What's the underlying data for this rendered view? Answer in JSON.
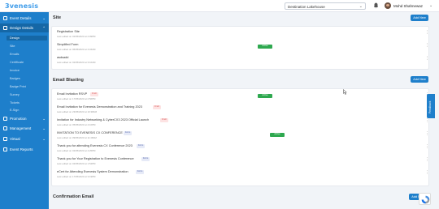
{
  "app": {
    "logo": "3venesis"
  },
  "header": {
    "event_select": "Destination Lakehouse",
    "user_name": "Mohd Shahnewaz"
  },
  "sidebar": {
    "items": [
      {
        "label": "Event Details",
        "chevron": "⌄"
      },
      {
        "label": "Design Details",
        "chevron": "⌃",
        "active": true
      },
      {
        "label": "Promotion",
        "chevron": "⌄"
      },
      {
        "label": "Management",
        "chevron": "⌄"
      },
      {
        "label": "Virtual",
        "chevron": "⌄"
      },
      {
        "label": "Event Reports",
        "chevron": ""
      }
    ],
    "sub_items": [
      "Design",
      "Site",
      "Emails",
      "Certificate",
      "Invoice",
      "Badges",
      "Badge Print",
      "Survey",
      "Tickets",
      "E-Sign"
    ]
  },
  "sections": {
    "site": {
      "title": "Site",
      "add_label": "Add New",
      "rows": [
        {
          "name": "Registration Site",
          "date": "Last edited on 02/05/2023 at 2:09PM",
          "tag": "",
          "badge": ""
        },
        {
          "name": "Simplified Form",
          "date": "Last edited on 06/05/2023 at 4:34AM",
          "tag": "",
          "badge": "Active"
        },
        {
          "name": "asdsadd",
          "date": "Last edited on 02/05/2023 at 3:10AM",
          "tag": "",
          "badge": ""
        }
      ]
    },
    "email": {
      "title": "Email Blasting",
      "add_label": "Add New",
      "rows": [
        {
          "name": "Email Invitation RSVP",
          "date": "Last edited on 17/05/2023 at 2:56PM",
          "tag": "Draft",
          "tag_type": "draft",
          "badge": "Active"
        },
        {
          "name": "Email Invitation for Evenesis Demonstration and Training 2023",
          "date": "Last edited on 23/05/2023 at 10:38AM",
          "tag": "Draft",
          "tag_type": "draft",
          "badge": ""
        },
        {
          "name": "Invitation for Industry Networking & CyberCX3 2023 Official Launch",
          "date": "Last edited on 05/05/2023 at 4:10PM",
          "tag": "Draft",
          "tag_type": "draft",
          "badge": ""
        },
        {
          "name": "INVITATION TO EVENESIS CX CONFERENCE",
          "date": "Last edited on 09/05/2023 at 11:48AM",
          "tag": "Form",
          "tag_type": "form",
          "badge": "Active"
        },
        {
          "name": "Thank you for attending Evenesis CX Conference 2023",
          "date": "Last edited on 02/05/2023 at 4:25PM",
          "tag": "Form",
          "tag_type": "form",
          "badge": ""
        },
        {
          "name": "Thank you for Your Registration to Evenesis Conference",
          "date": "Last edited on 02/05/2023 at 1:54PM",
          "tag": "Form",
          "tag_type": "form",
          "badge": ""
        },
        {
          "name": "eCert for Attending Evenesis System Demonstration",
          "date": "Last edited on 17/05/2023 at 3:19PM",
          "tag": "Form",
          "tag_type": "form",
          "badge": ""
        }
      ]
    },
    "confirmation": {
      "title": "Confirmation Email",
      "add_label": "Add New"
    }
  },
  "feedback_label": "Feedback",
  "colors": {
    "accent": "#1e7fcb",
    "active_badge": "#2ea84f"
  }
}
